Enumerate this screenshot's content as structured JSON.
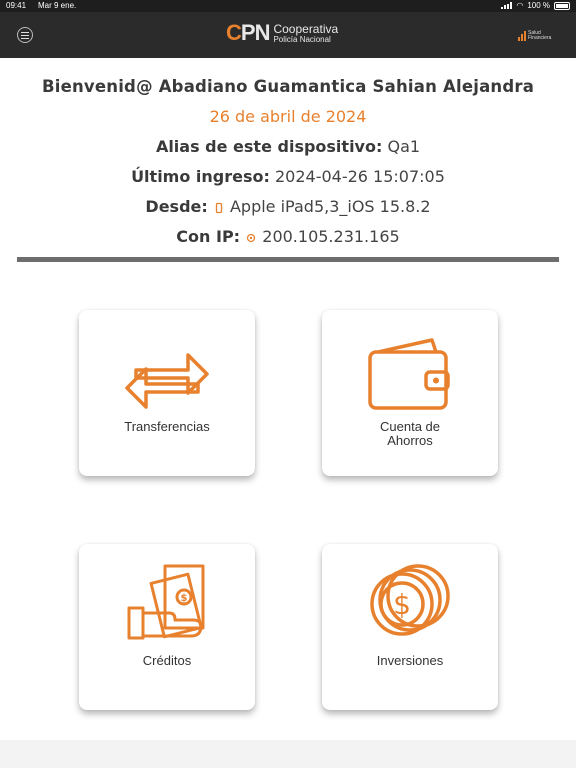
{
  "status_bar": {
    "time": "09:41",
    "date": "Mar 9 ene.",
    "battery": "100 %"
  },
  "header": {
    "logo_mark": "PN",
    "logo_c": "C",
    "logo_line1": "Cooperativa",
    "logo_line2": "Policía Nacional",
    "salud_line1": "Salud",
    "salud_line2": "Financiera"
  },
  "welcome": {
    "greeting": "Bienvenid@ Abadiano Guamantica Sahian Alejandra",
    "date": "26 de abril de 2024",
    "alias_label": "Alias de este dispositivo:",
    "alias_value": "Qa1",
    "last_login_label": "Último ingreso:",
    "last_login_value": "2024-04-26 15:07:05",
    "from_label": "Desde:",
    "from_value": "Apple iPad5,3_iOS 15.8.2",
    "ip_label": "Con IP:",
    "ip_value": "200.105.231.165"
  },
  "cards": {
    "transfers": {
      "label": "Transferencias",
      "icon": "arrows-exchange-icon"
    },
    "savings": {
      "label1": "Cuenta de",
      "label2": "Ahorros",
      "icon": "wallet-icon"
    },
    "credits": {
      "label": "Créditos",
      "icon": "hand-money-icon"
    },
    "investments": {
      "label": "Inversiones",
      "icon": "coins-icon"
    }
  },
  "colors": {
    "accent": "#e8812e",
    "header_bg": "#2b2b2b",
    "divider": "#6d6d6d"
  }
}
